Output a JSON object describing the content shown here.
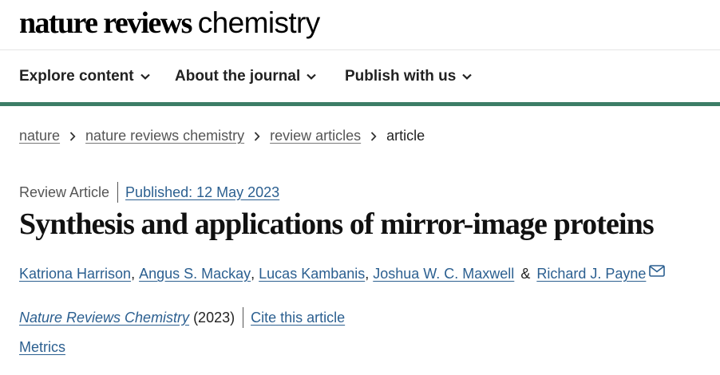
{
  "header": {
    "logo_bold": "nature reviews",
    "logo_light": "chemistry"
  },
  "nav": {
    "items": [
      {
        "label": "Explore content",
        "icon": "chevron-down-icon"
      },
      {
        "label": "About the journal",
        "icon": "chevron-down-icon"
      },
      {
        "label": "Publish with us",
        "icon": "chevron-down-icon"
      }
    ],
    "accent_color": "#3c7d66"
  },
  "breadcrumb": {
    "items": [
      "nature",
      "nature reviews chemistry",
      "review articles"
    ],
    "current": "article",
    "separator_icon": "chevron-right-icon"
  },
  "article": {
    "type": "Review Article",
    "published": "Published: 12 May 2023",
    "title": "Synthesis and applications of mirror-image proteins",
    "authors": [
      "Katriona Harrison",
      "Angus S. Mackay",
      "Lucas Kambanis",
      "Joshua W. C. Maxwell",
      "Richard J. Payne"
    ],
    "separators": [
      ",",
      ",",
      ",",
      "&"
    ],
    "corresponding_icon": "mail-icon",
    "journal": "Nature Reviews Chemistry",
    "year": "(2023)",
    "cite_label": "Cite this article",
    "metrics_label": "Metrics",
    "link_color": "#2b5f90"
  }
}
